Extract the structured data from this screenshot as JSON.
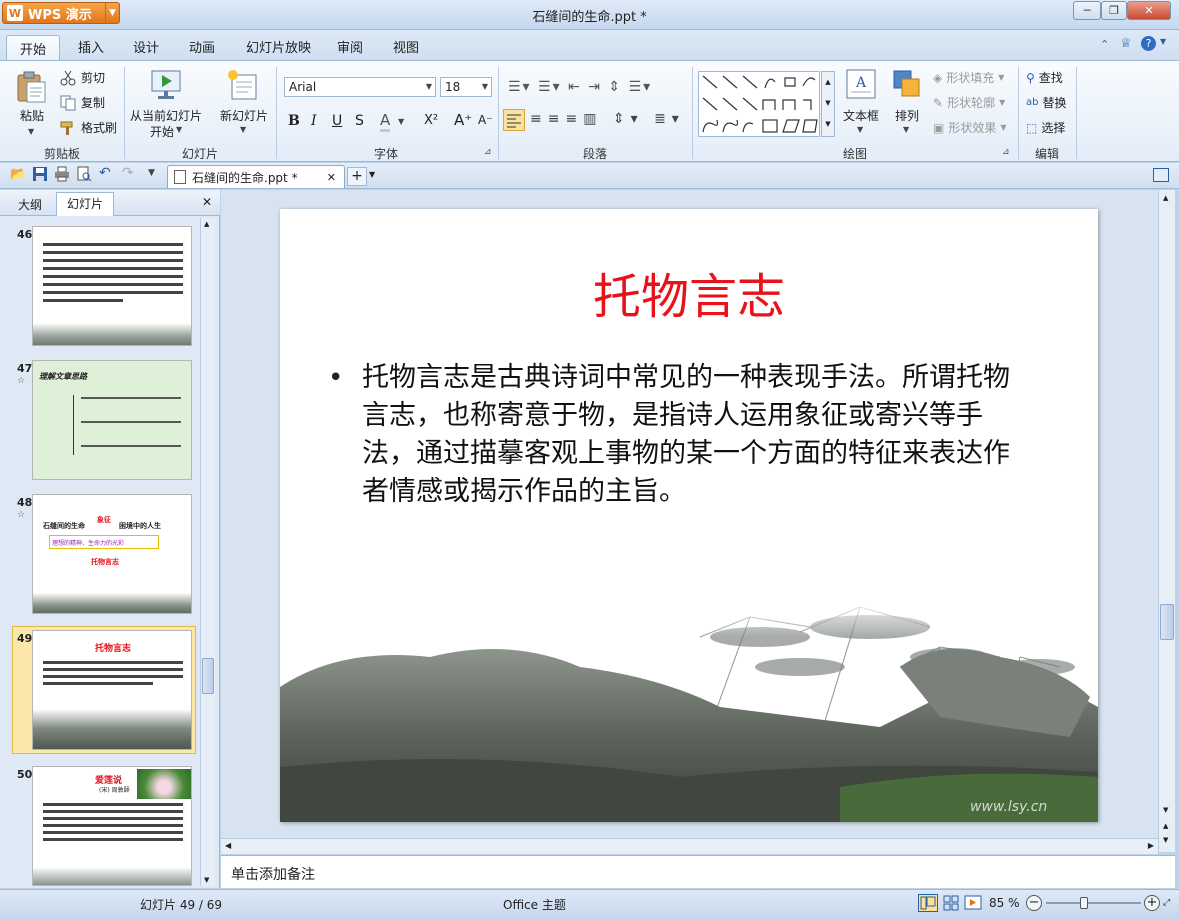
{
  "app": {
    "brand": "WPS 演示",
    "title": "石缝间的生命.ppt *"
  },
  "window": {
    "minimize": "─",
    "restore": "❐",
    "close": "✕"
  },
  "tabs": [
    "开始",
    "插入",
    "设计",
    "动画",
    "幻灯片放映",
    "审阅",
    "视图"
  ],
  "ribbon": {
    "clipboard": {
      "paste": "粘贴",
      "cut": "剪切",
      "copy": "复制",
      "format_painter": "格式刷",
      "label": "剪贴板"
    },
    "slides": {
      "from_current_1": "从当前幻灯片",
      "from_current_2": "开始",
      "new_slide": "新幻灯片",
      "label": "幻灯片"
    },
    "font": {
      "family": "Arial",
      "size": "18",
      "label": "字体"
    },
    "paragraph": {
      "label": "段落"
    },
    "drawing": {
      "textbox": "文本框",
      "arrange": "排列",
      "fill": "形状填充",
      "outline": "形状轮廓",
      "effect": "形状效果",
      "label": "绘图"
    },
    "editing": {
      "find": "查找",
      "replace": "替换",
      "select": "选择",
      "label": "编辑"
    }
  },
  "doc_tab": "石缝间的生命.ppt *",
  "panel_tabs": {
    "outline": "大纲",
    "slides": "幻灯片"
  },
  "thumbnails": [
    {
      "num": "46"
    },
    {
      "num": "47",
      "title": "理解文章思路"
    },
    {
      "num": "48",
      "left": "石缝间的生命",
      "mid": "象征",
      "right": "困境中的人生",
      "band": "理想的精神、生命力的光彩",
      "bottom": "托物言志"
    },
    {
      "num": "49",
      "title": "托物言志"
    },
    {
      "num": "50",
      "title": "爱莲说",
      "subtitle": "(宋) 周敦颐"
    }
  ],
  "slide": {
    "title": "托物言志",
    "bullet": "•",
    "body": "托物言志是古典诗词中常见的一种表现手法。所谓托物言志，也称寄意于物，是指诗人运用象征或寄兴等手法，通过描摹客观上事物的某一个方面的特征来表达作者情感或揭示作品的主旨。",
    "watermark": "www.lsy.cn"
  },
  "notes_placeholder": "单击添加备注",
  "status": {
    "slide_counter": "幻灯片 49 / 69",
    "theme": "Office 主题",
    "zoom": "85 %"
  }
}
